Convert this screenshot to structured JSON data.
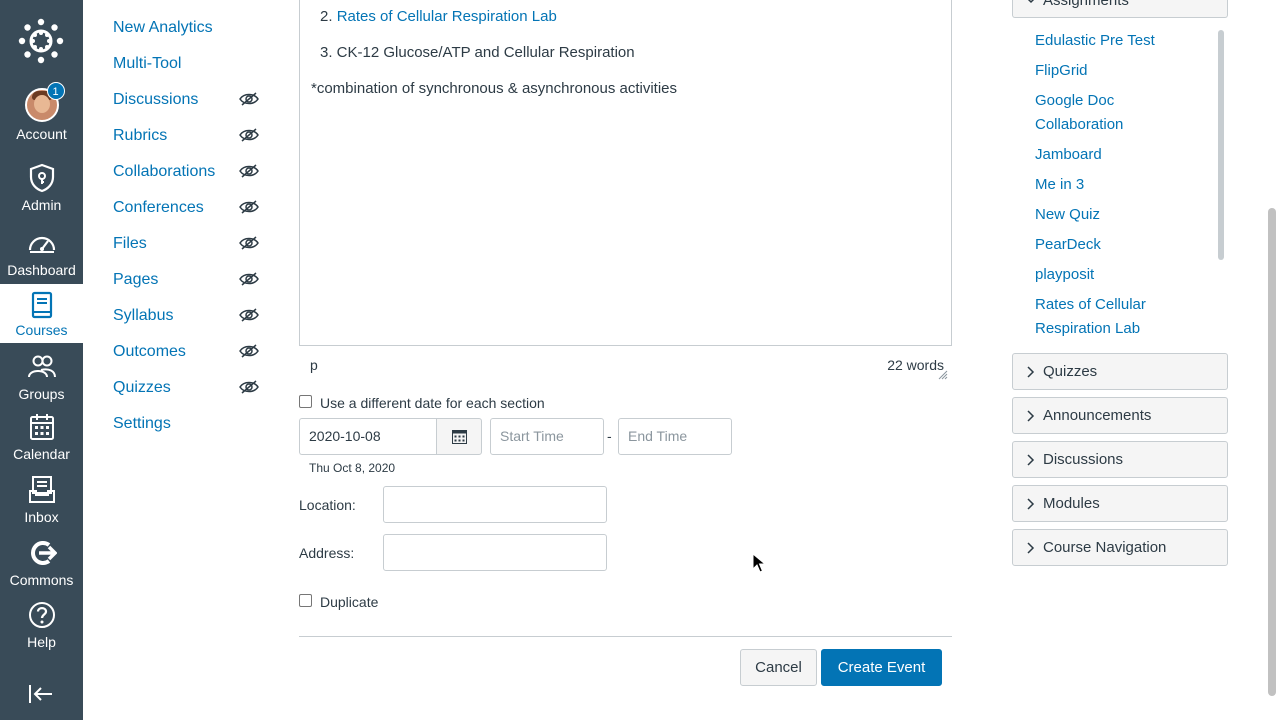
{
  "global_nav": {
    "logo_icon": "canvas-logo-icon",
    "account": {
      "label": "Account",
      "badge": "1",
      "icon": "avatar"
    },
    "admin": {
      "label": "Admin",
      "icon": "shield-icon"
    },
    "dashboard": {
      "label": "Dashboard",
      "icon": "dashboard-icon"
    },
    "courses": {
      "label": "Courses",
      "icon": "book-icon"
    },
    "groups": {
      "label": "Groups",
      "icon": "groups-icon"
    },
    "calendar": {
      "label": "Calendar",
      "icon": "calendar-icon"
    },
    "inbox": {
      "label": "Inbox",
      "icon": "inbox-icon"
    },
    "commons": {
      "label": "Commons",
      "icon": "commons-icon"
    },
    "help": {
      "label": "Help",
      "icon": "help-icon"
    },
    "collapse_icon": "collapse-nav-icon"
  },
  "course_nav": {
    "items": [
      {
        "label": "New Analytics",
        "hidden": false
      },
      {
        "label": "Multi-Tool",
        "hidden": false
      },
      {
        "label": "Discussions",
        "hidden": true
      },
      {
        "label": "Rubrics",
        "hidden": true
      },
      {
        "label": "Collaborations",
        "hidden": true
      },
      {
        "label": "Conferences",
        "hidden": true
      },
      {
        "label": "Files",
        "hidden": true
      },
      {
        "label": "Pages",
        "hidden": true
      },
      {
        "label": "Syllabus",
        "hidden": true
      },
      {
        "label": "Outcomes",
        "hidden": true
      },
      {
        "label": "Quizzes",
        "hidden": true
      },
      {
        "label": "Settings",
        "hidden": false
      }
    ]
  },
  "editor": {
    "line2_number": "2.",
    "line2_link": "Rates of Cellular Respiration Lab",
    "line3": "3. CK-12 Glucose/ATP and Cellular Respiration",
    "line4": "*combination of synchronous & asynchronous activities",
    "path": "p",
    "word_count": "22 words"
  },
  "form": {
    "different_date_label": "Use a different date for each section",
    "date_value": "2020-10-08",
    "date_hint": "Thu Oct 8, 2020",
    "start_time_placeholder": "Start Time",
    "time_separator": "-",
    "end_time_placeholder": "End Time",
    "location_label": "Location:",
    "location_value": "",
    "address_label": "Address:",
    "address_value": "",
    "duplicate_label": "Duplicate",
    "cancel_label": "Cancel",
    "create_label": "Create Event"
  },
  "sidebar": {
    "open_section": "Assignments",
    "assignments": [
      "Edulastic Pre Test",
      "FlipGrid",
      "Google Doc Collaboration",
      "Jamboard",
      "Me in 3",
      "New Quiz",
      "PearDeck",
      "playposit",
      "Rates of Cellular Respiration Lab"
    ],
    "sections": [
      "Quizzes",
      "Announcements",
      "Discussions",
      "Modules",
      "Course Navigation"
    ]
  },
  "colors": {
    "nav_bg": "#394b58",
    "link": "#0374b5",
    "primary_button": "#0374b5",
    "text": "#2d3b45",
    "border": "#c7cdd1"
  }
}
